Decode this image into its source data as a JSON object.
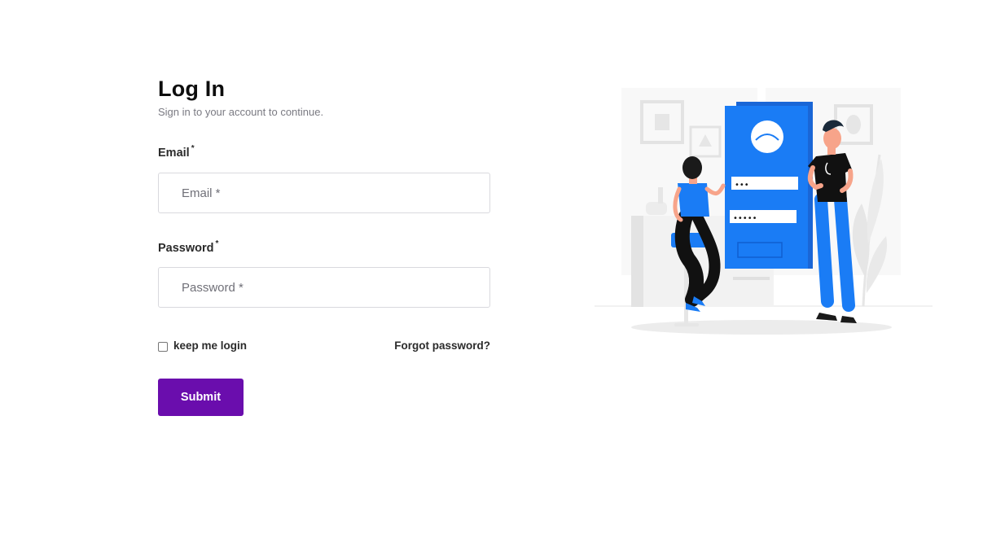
{
  "login": {
    "title": "Log In",
    "subtitle": "Sign in to your account to continue.",
    "email": {
      "label": "Email",
      "required_mark": "*",
      "placeholder": "Email *",
      "value": ""
    },
    "password": {
      "label": "Password",
      "required_mark": "*",
      "placeholder": "Password *",
      "value": ""
    },
    "remember_label": "keep me login",
    "remember_checked": false,
    "forgot_label": "Forgot password?",
    "submit_label": "Submit"
  },
  "illustration": {
    "password_dots_short": "•••",
    "password_dots_long": "•••••"
  },
  "colors": {
    "accent": "#6a0dad",
    "illustration_blue": "#1a7cf5",
    "text_dark": "#0d0d0d",
    "text_muted": "#7a7a82",
    "input_border": "#d9d9de"
  }
}
